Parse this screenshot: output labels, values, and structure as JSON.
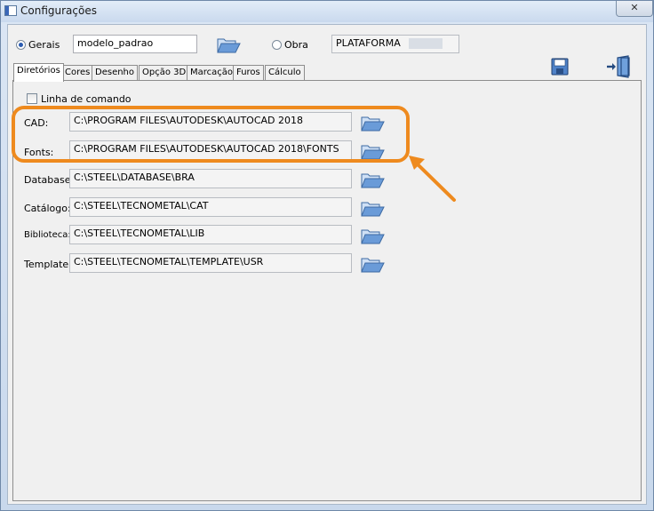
{
  "window": {
    "title": "Configurações",
    "close_glyph": "✕"
  },
  "scope": {
    "gerais_label": "Gerais",
    "gerais_value": "modelo_padrao",
    "obra_label": "Obra",
    "obra_value": "PLATAFORMA",
    "selected": "Gerais"
  },
  "tabs": [
    {
      "label": "Diretórios",
      "active": true
    },
    {
      "label": "Cores"
    },
    {
      "label": "Desenho"
    },
    {
      "label": "Opção 3D"
    },
    {
      "label": "Marcação"
    },
    {
      "label": "Furos"
    },
    {
      "label": "Cálculo"
    }
  ],
  "diretorios": {
    "linha_comando_label": "Linha de comando",
    "rows": [
      {
        "label": "CAD:",
        "path": "C:\\PROGRAM FILES\\AUTODESK\\AUTOCAD 2018"
      },
      {
        "label": "Fonts:",
        "path": "C:\\PROGRAM FILES\\AUTODESK\\AUTOCAD 2018\\FONTS"
      },
      {
        "label": "Database:",
        "path": "C:\\STEEL\\DATABASE\\BRA"
      },
      {
        "label": "Catálogo:",
        "path": "C:\\STEEL\\TECNOMETAL\\CAT"
      },
      {
        "label": "Biblioteca:",
        "path": "C:\\STEEL\\TECNOMETAL\\LIB"
      },
      {
        "label": "Template:",
        "path": "C:\\STEEL\\TECNOMETAL\\TEMPLATE\\USR"
      }
    ]
  },
  "icons": {
    "folder": "folder-icon",
    "save": "save-icon",
    "exit": "exit-icon"
  },
  "colors": {
    "highlight": "#ee8a1e",
    "folder": "#6a9bd8"
  }
}
